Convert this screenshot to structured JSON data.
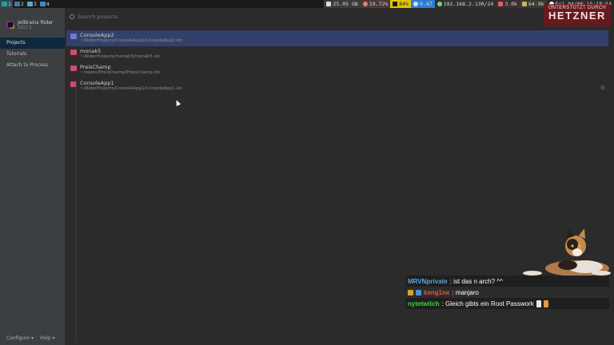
{
  "topbar": {
    "workspaces": [
      {
        "num": "1",
        "color": "#2a9d8f",
        "active": true
      },
      {
        "num": "2",
        "color": "#4c7a9e",
        "active": false
      },
      {
        "num": "3",
        "color": "#5ea3d6",
        "active": false
      },
      {
        "num": "4",
        "color": "#3b8ad6",
        "active": false
      }
    ],
    "disk": "25.05 GB",
    "cpu": "19.72%",
    "battery": "84%",
    "load": "0.47",
    "ip": "192.168.2.130/24",
    "net_down": "3.0k",
    "net_up": "64.9k",
    "clock": "Fri 04/06 15:18:54"
  },
  "hetzner": {
    "small": "UNTERSTÜTZT DURCH",
    "big": "HETZNER"
  },
  "app": {
    "name": "JetBrains Rider",
    "version": "2017.1"
  },
  "nav": {
    "projects": "Projects",
    "tutorials": "Tutorials",
    "attach": "Attach to Process"
  },
  "footer": {
    "configure": "Configure ▾",
    "help": "Help ▾"
  },
  "search": {
    "placeholder": "Search projects"
  },
  "projects": [
    {
      "name": "ConsoleApp2",
      "path": "~/RiderProjects/ConsoleApp2/ConsoleApp2.sln",
      "color": "#6a7bd1"
    },
    {
      "name": "monak5",
      "path": "~/RiderProjects/monak5/monak5.sln",
      "color": "#d14a6a"
    },
    {
      "name": "PreisChamp",
      "path": "~/repos/PreisChamp/PreisChamp.sln",
      "color": "#d14a6a"
    },
    {
      "name": "ConsoleApp1",
      "path": "~/RiderProjects/ConsoleApp1/ConsoleApp1.sln",
      "color": "#d14a6a"
    }
  ],
  "chat": [
    {
      "user": "MRVNprivate",
      "user_color": "#5aa3e6",
      "text": ": ist das n arch? ^^"
    },
    {
      "user": "keng1ne",
      "user_color": "#e0553a",
      "text": ": manjaro"
    },
    {
      "user": "nytetwitch",
      "user_color": "#3ed13e",
      "text": ": Gleich gibts ein Root Passwork"
    }
  ],
  "colors": {
    "accent": "#33416a",
    "sidebar": "#3c3f41",
    "editor": "#2b2b2b"
  }
}
